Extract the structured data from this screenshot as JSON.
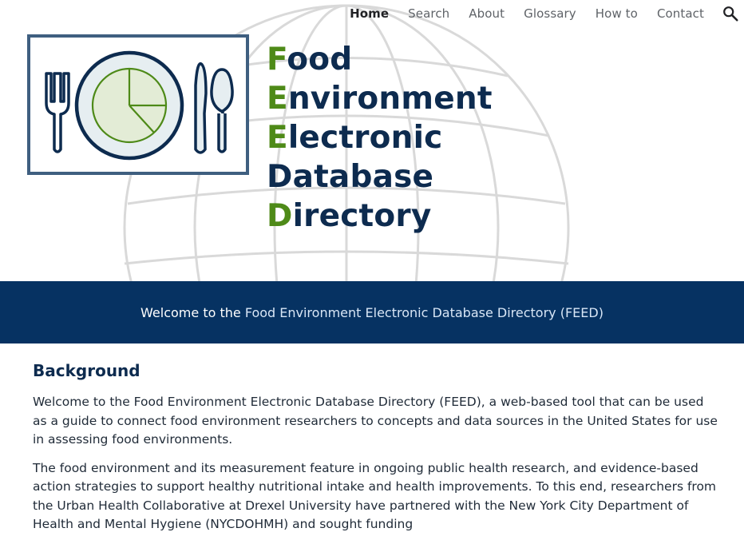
{
  "nav": {
    "items": [
      {
        "label": "Home",
        "active": true
      },
      {
        "label": "Search",
        "active": false
      },
      {
        "label": "About",
        "active": false
      },
      {
        "label": "Glossary",
        "active": false
      },
      {
        "label": "How to",
        "active": false
      },
      {
        "label": "Contact",
        "active": false
      }
    ],
    "search_icon": "search-icon"
  },
  "logo": {
    "icon": "plate-fork-knife-spoon-icon",
    "colors": {
      "border": "#3f5f80",
      "plate_fill": "#e6eef1",
      "pie_fill": "#e3ecd6",
      "pie_stroke": "#4e8a18",
      "utensil": "#0d2b4f"
    }
  },
  "title": {
    "lines": [
      {
        "initial": "F",
        "rest": "ood"
      },
      {
        "initial": "E",
        "rest": "nvironment"
      },
      {
        "initial": "E",
        "rest": "lectronic"
      },
      {
        "initial": "",
        "rest": "Database"
      },
      {
        "initial": "D",
        "rest": "irectory"
      }
    ],
    "colors": {
      "main": "#0d2b4f",
      "initial": "#4e8a18"
    }
  },
  "banner": {
    "prefix": "Welcome to the ",
    "highlight": "Food Environment Electronic Database Directory (FEED)",
    "background": "#063262"
  },
  "background_section": {
    "heading": "Background",
    "paragraphs": [
      "Welcome to the Food Environment Electronic Database Directory (FEED), a web-based tool that can be used as a guide to connect food environment researchers to concepts and data sources in the United States for use in assessing food environments.",
      "The food environment and its measurement feature in ongoing public health research, and evidence-based action strategies to support healthy nutritional intake and health improvements. To this end, researchers from the Urban Health Collaborative at Drexel University have partnered with the New York City Department of Health and Mental Hygiene (NYCDOHMH) and sought funding"
    ]
  }
}
